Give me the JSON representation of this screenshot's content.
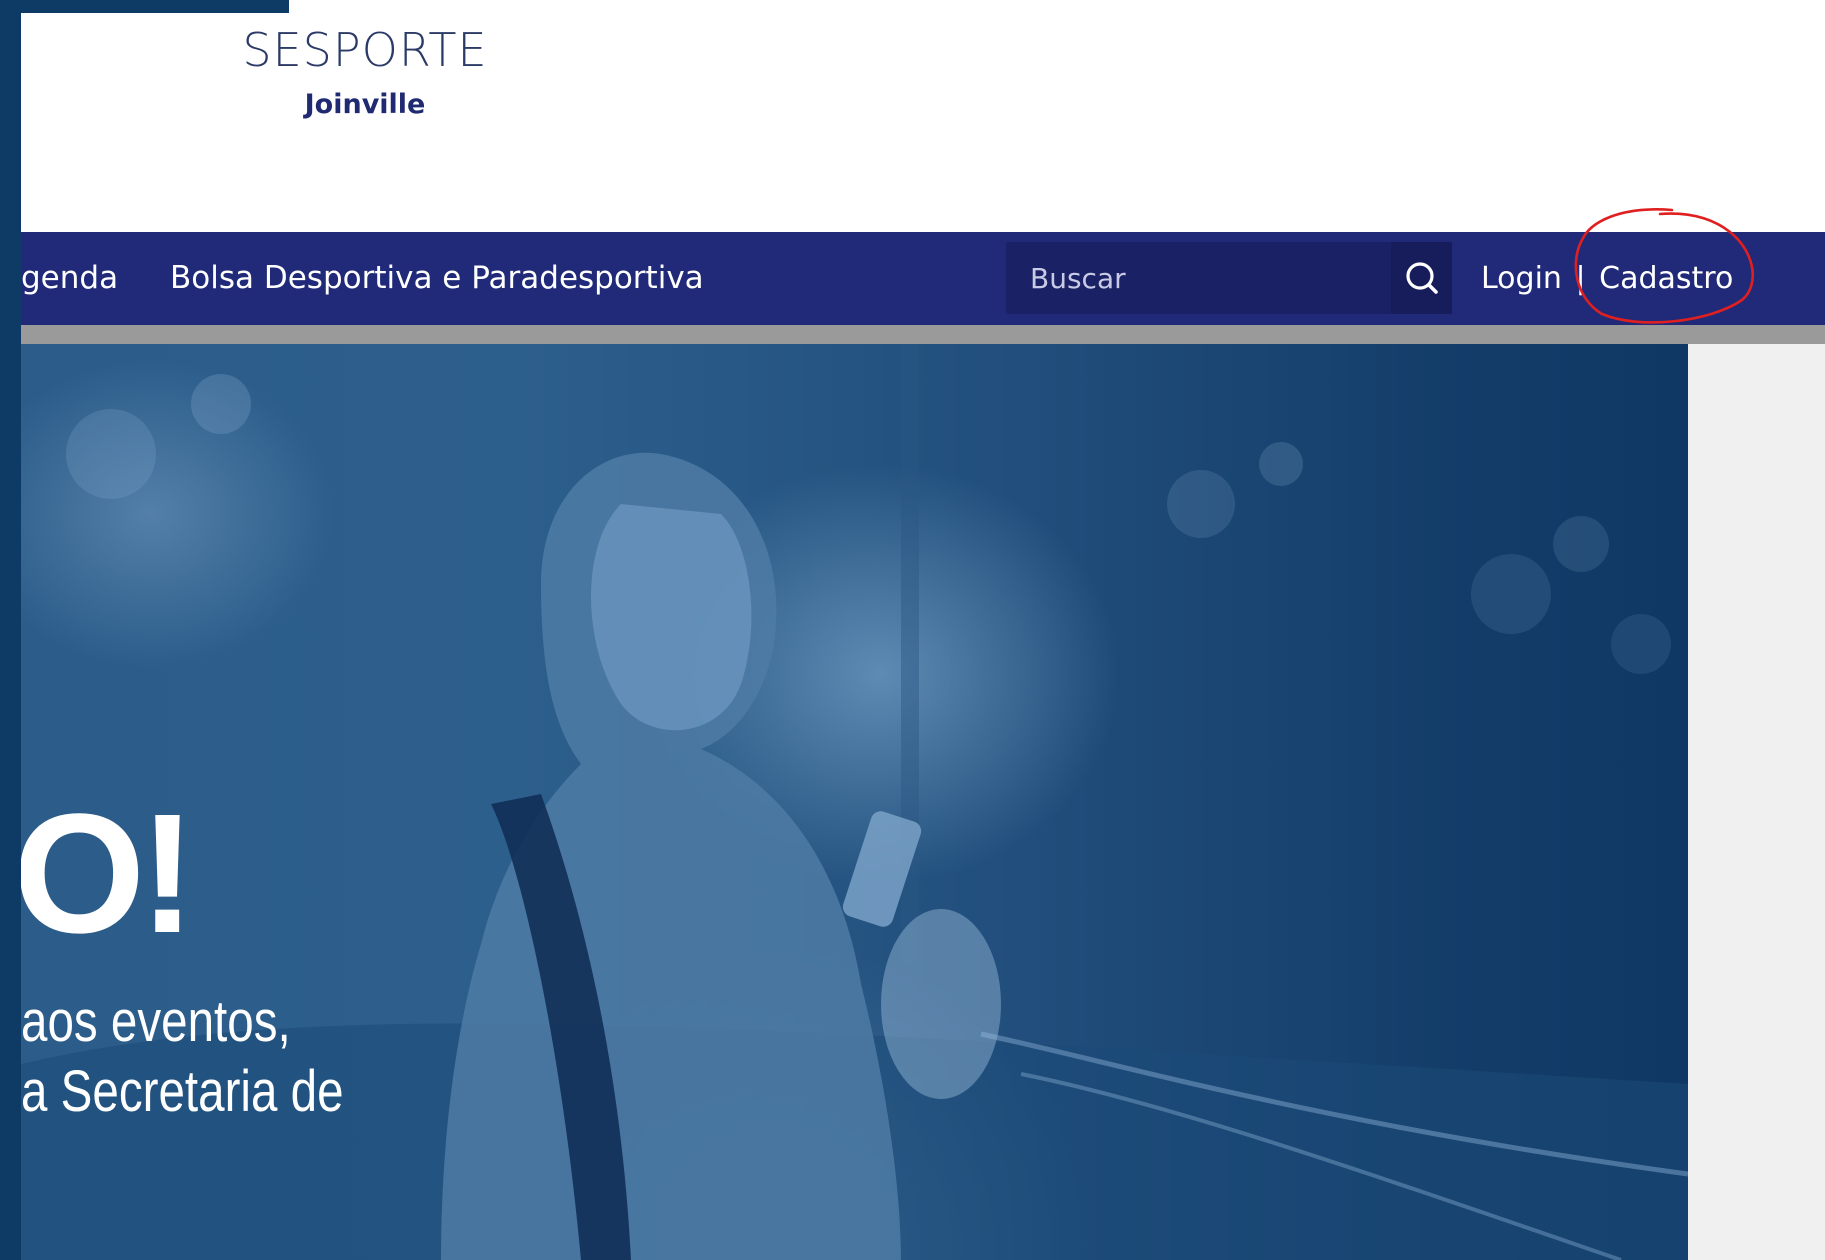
{
  "brand": {
    "title": "SESPORTE",
    "subtitle": "Joinville"
  },
  "nav": {
    "items": [
      {
        "label": "genda"
      },
      {
        "label": "Bolsa Desportiva e Paradesportiva"
      }
    ]
  },
  "search": {
    "placeholder": "Buscar",
    "icon": "search-icon"
  },
  "auth": {
    "login": "Login",
    "separator": "|",
    "register": "Cadastro"
  },
  "hero": {
    "headline": "O!",
    "line1": "aos eventos,",
    "line2": "a Secretaria de"
  },
  "colors": {
    "navbar": "#202a78",
    "side_bar": "#0e3a66",
    "annotation": "#e02020"
  }
}
